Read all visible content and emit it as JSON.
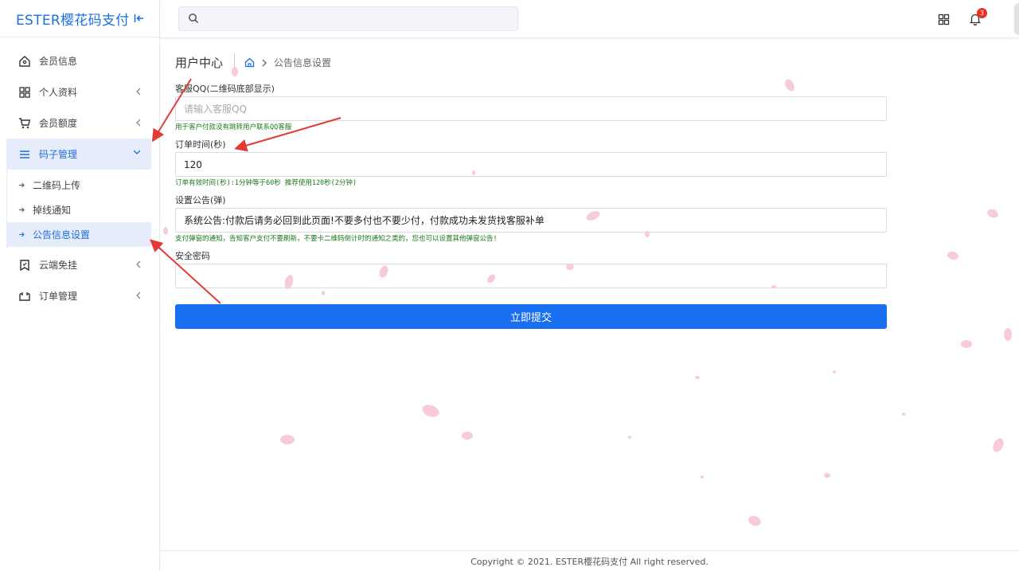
{
  "brand": {
    "title": "ESTER樱花码支付"
  },
  "sidebar": {
    "items": [
      {
        "label": "会员信息",
        "icon": "home-icon"
      },
      {
        "label": "个人资料",
        "icon": "grid-icon"
      },
      {
        "label": "会员额度",
        "icon": "cart-icon"
      },
      {
        "label": "码子管理",
        "icon": "menu-icon",
        "expanded": true
      },
      {
        "label": "云端免挂",
        "icon": "bookmark-icon"
      },
      {
        "label": "订单管理",
        "icon": "box-icon"
      }
    ],
    "subitems": [
      {
        "label": "二维码上传"
      },
      {
        "label": "掉线通知"
      },
      {
        "label": "公告信息设置",
        "active": true
      }
    ]
  },
  "header": {
    "search_placeholder": "",
    "notification_count": "3"
  },
  "page": {
    "title": "用户中心",
    "breadcrumb_current": "公告信息设置"
  },
  "form": {
    "qq": {
      "label": "客服QQ(二维码底部显示)",
      "placeholder": "请输入客服QQ",
      "value": "",
      "hint": "用于客户付款没有跳转用户联系QQ客服"
    },
    "order_time": {
      "label": "订单时间(秒)",
      "value": "120",
      "hint": "订单有效时间(秒):1分钟等于60秒 推荐使用120秒(2分钟)"
    },
    "notice": {
      "label": "设置公告(弹)",
      "value": "系统公告:付款后请务必回到此页面!不要多付也不要少付，付款成功未发货找客服补单",
      "hint": "支付弹窗的通知，告知客户支付不要刷新，不要卡二维码倒计时的通知之类的，您也可以设置其他弹窗公告!"
    },
    "password": {
      "label": "安全密码",
      "value": ""
    },
    "submit_label": "立即提交"
  },
  "footer": {
    "text": "Copyright © 2021. ESTER樱花码支付 All right reserved."
  },
  "colors": {
    "accent": "#1e6fe0",
    "button": "#1a6ff0",
    "hint": "#1a7a1a",
    "badge": "#e8322a",
    "annotation": "#e53935",
    "petal": "#f7c6d3"
  }
}
